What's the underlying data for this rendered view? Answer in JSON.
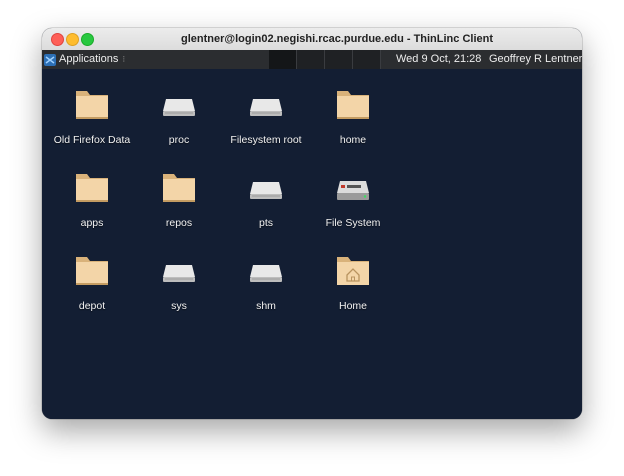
{
  "window": {
    "title": "glentner@login02.negishi.rcac.purdue.edu - ThinLinc Client"
  },
  "panel": {
    "applications_label": "Applications",
    "applications_separator": "⁝",
    "clock": "Wed  9 Oct, 21:28",
    "user": "Geoffrey R Lentner"
  },
  "desktop": {
    "items": [
      {
        "label": "Old Firefox Data",
        "icon": "folder-icon"
      },
      {
        "label": "proc",
        "icon": "drive-icon"
      },
      {
        "label": "Filesystem root",
        "icon": "drive-icon"
      },
      {
        "label": "home",
        "icon": "folder-icon"
      },
      {
        "label": "apps",
        "icon": "folder-icon"
      },
      {
        "label": "repos",
        "icon": "folder-icon"
      },
      {
        "label": "pts",
        "icon": "drive-icon"
      },
      {
        "label": "File System",
        "icon": "harddisk-icon"
      },
      {
        "label": "depot",
        "icon": "folder-icon"
      },
      {
        "label": "sys",
        "icon": "drive-icon"
      },
      {
        "label": "shm",
        "icon": "drive-icon"
      },
      {
        "label": "Home",
        "icon": "home-folder-icon"
      }
    ]
  },
  "dock": {
    "items": [
      {
        "icon": "show-desktop-icon"
      },
      {
        "icon": "terminal-icon"
      },
      {
        "icon": "file-manager-icon"
      },
      {
        "icon": "web-browser-icon"
      },
      {
        "icon": "app-finder-icon"
      },
      {
        "icon": "folder-icon"
      }
    ]
  },
  "colors": {
    "desktop_bg": "#131e33",
    "panel_bg": "#2b2d30",
    "folder": "#f3d5a8",
    "accent_blue": "#21a0e0"
  }
}
